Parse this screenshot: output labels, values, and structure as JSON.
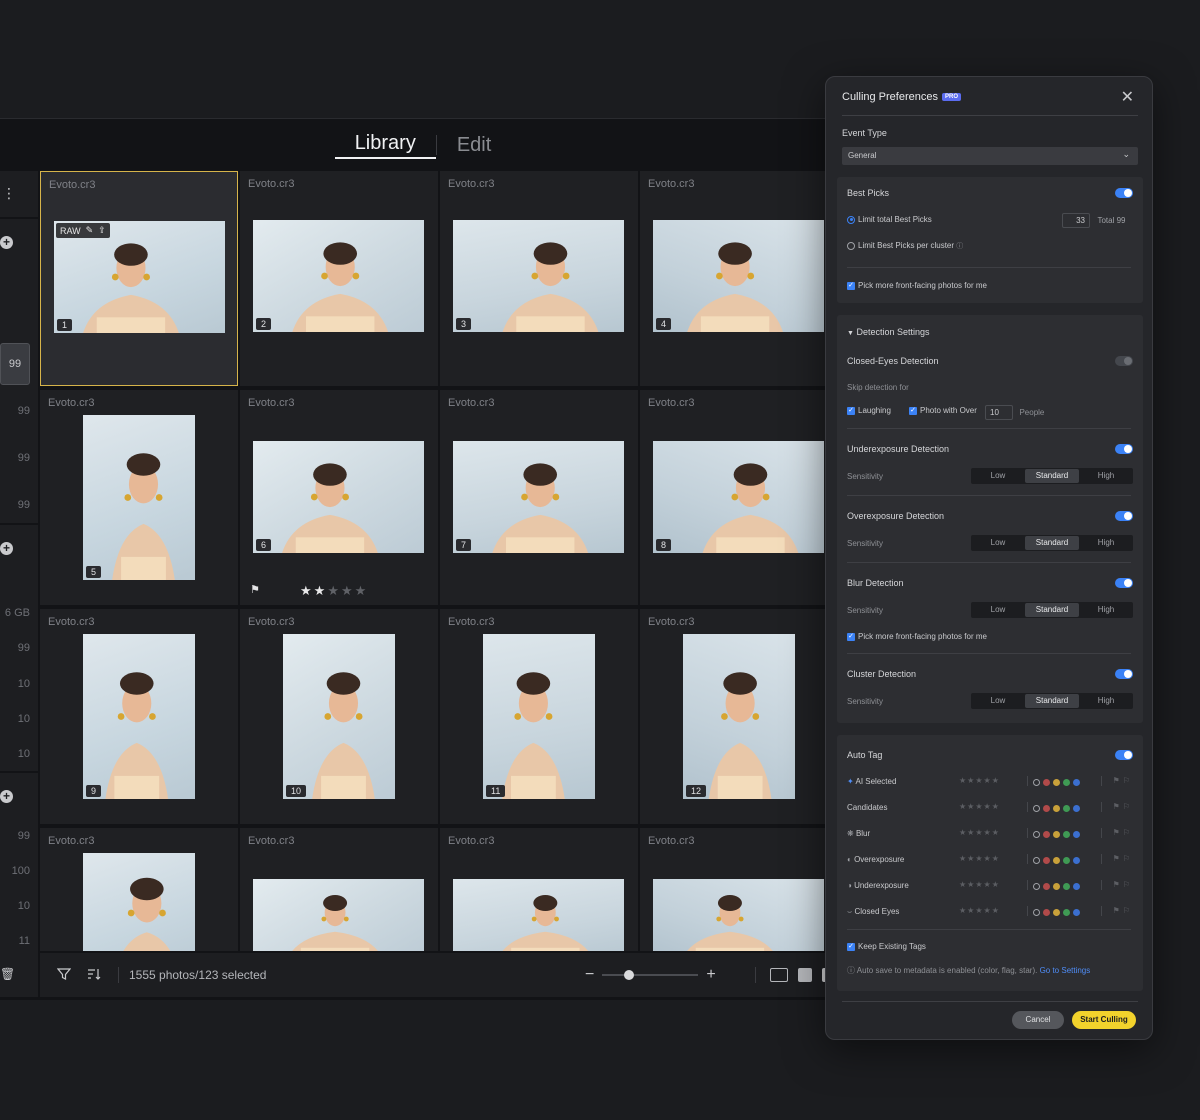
{
  "top_tabs": {
    "library": "Library",
    "edit": "Edit"
  },
  "left_strip": {
    "values": [
      "99",
      "99",
      "99",
      "99",
      "6 GB",
      "99",
      "10",
      "10",
      "10",
      "99",
      "100",
      "10",
      "11"
    ],
    "more_icon": "more-vertical-icon"
  },
  "grid": {
    "cells": [
      {
        "name": "Evoto.cr3",
        "number": "1"
      },
      {
        "name": "Evoto.cr3",
        "number": "2"
      },
      {
        "name": "Evoto.cr3",
        "number": "3"
      },
      {
        "name": "Evoto.cr3",
        "number": "4"
      },
      {
        "name": "Evoto.cr3",
        "number": "5"
      },
      {
        "name": "Evoto.cr3",
        "number": "6"
      },
      {
        "name": "Evoto.cr3",
        "number": "7"
      },
      {
        "name": "Evoto.cr3",
        "number": "8"
      },
      {
        "name": "Evoto.cr3",
        "number": "9"
      },
      {
        "name": "Evoto.cr3",
        "number": "10"
      },
      {
        "name": "Evoto.cr3",
        "number": "11"
      },
      {
        "name": "Evoto.cr3",
        "number": "12"
      },
      {
        "name": "Evoto.cr3",
        "number": ""
      },
      {
        "name": "Evoto.cr3",
        "number": ""
      },
      {
        "name": "Evoto.cr3",
        "number": ""
      },
      {
        "name": "Evoto.cr3",
        "number": ""
      }
    ],
    "raw_badge": "RAW",
    "cell6_rating": 2
  },
  "bottom_bar": {
    "count_text": "1555 photos/123 selected"
  },
  "panel": {
    "title": "Culling Preferences",
    "pro_badge": "PRO",
    "event_type_label": "Event Type",
    "event_type_value": "General",
    "best_picks": {
      "title": "Best Picks",
      "limit_total": "Limit total Best Picks",
      "limit_total_value": "33",
      "total_text": "Total 99",
      "limit_cluster": "Limit Best Picks per cluster",
      "front_facing": "Pick more front-facing photos for me"
    },
    "detection": {
      "title": "Detection Settings",
      "closed_eyes": "Closed-Eyes Detection",
      "skip_for": "Skip detection  for",
      "laughing": "Laughing",
      "photo_over": "Photo with Over",
      "people_count": "10",
      "people": "People",
      "underexposure": "Underexposure Detection",
      "overexposure": "Overexposure Detection",
      "blur": "Blur Detection",
      "blur_front": "Pick more front-facing photos for me",
      "cluster": "Cluster Detection",
      "sensitivity": "Sensitivity",
      "levels": [
        "Low",
        "Standard",
        "High"
      ]
    },
    "auto_tag": {
      "title": "Auto Tag",
      "rows": [
        {
          "name": "AI Selected",
          "icon": "sparkle-icon"
        },
        {
          "name": "Candidates",
          "icon": ""
        },
        {
          "name": "Blur",
          "icon": "blur-icon"
        },
        {
          "name": "Overexposure",
          "icon": "overexposure-icon"
        },
        {
          "name": "Underexposure",
          "icon": "underexposure-icon"
        },
        {
          "name": "Closed Eyes",
          "icon": "closed-eyes-icon"
        }
      ],
      "keep_existing": "Keep Existing Tags",
      "auto_save": "Auto save to metadata is enabled  (color, flag, star).",
      "go_to_settings": "Go to Settings"
    },
    "buttons": {
      "cancel": "Cancel",
      "start": "Start Culling"
    }
  },
  "colors": {
    "accent_blue": "#3b82f6",
    "selection_yellow": "#d6b44a",
    "start_button": "#f2d22c",
    "tag_colors": [
      "#888888",
      "#b14a4a",
      "#c8a13a",
      "#3f9a54",
      "#3b6fd0"
    ]
  }
}
